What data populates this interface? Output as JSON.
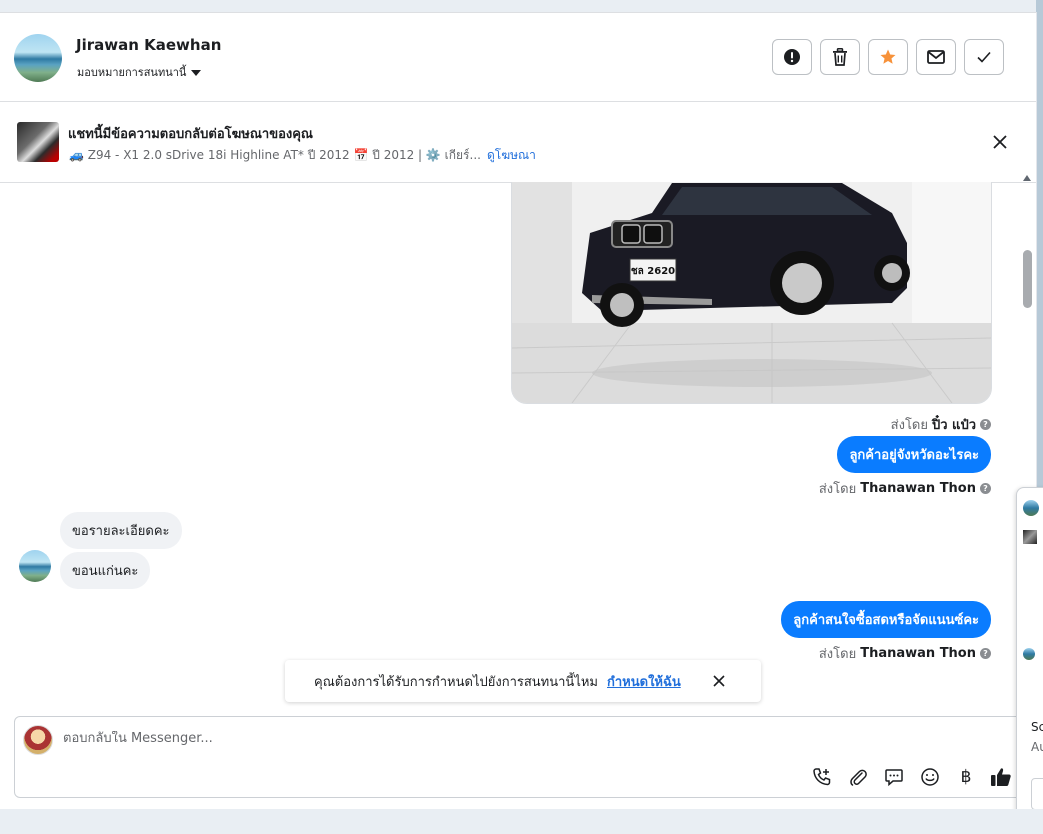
{
  "header": {
    "contact_name": "Jirawan Kaewhan",
    "assign_label": "มอบหมายการสนทนานี้",
    "actions": [
      "alert-icon",
      "trash-icon",
      "star-icon",
      "envelope-icon",
      "check-icon"
    ],
    "star_color": "#f7923a"
  },
  "ad": {
    "title": "แชทนี้มีข้อความตอบกลับต่อโฆษณาของคุณ",
    "description": "🚙 Z94 - X1 2.0 sDrive 18i Highline AT* ปี 2012 📅 ปี 2012 | ⚙️ เกียร์...",
    "link": "ดูโฆษณา"
  },
  "messages": {
    "photo_plate": "ชล 2620",
    "sent_by_prefix": "ส่งโดย",
    "sender_1": "ปิ๋ว แป๋ว",
    "out_1": "ลูกค้าอยู่จังหวัดอะไรคะ",
    "sender_2": "Thanawan Thon",
    "in_1": "ขอรายละเอียดคะ",
    "in_2": "ขอนแก่นคะ",
    "out_2": "ลูกค้าสนใจซื้อสดหรือจัดแนนซ์คะ",
    "sender_3": "Thanawan Thon",
    "bubble_color": "#0a7cff"
  },
  "toast": {
    "text": "คุณต้องการได้รับการกำหนดไปยังการสนทนานี้ไหม",
    "link": "กำหนดให้ฉัน"
  },
  "composer": {
    "placeholder": "ตอบกลับใน Messenger...",
    "tools": [
      "call-add-icon",
      "paperclip-icon",
      "chat-bubble-icon",
      "emoji-icon",
      "baht-icon",
      "thumbs-up-icon"
    ],
    "baht_symbol": "฿"
  },
  "side_peek": {
    "text_1": "Sc",
    "text_2": "Au"
  }
}
